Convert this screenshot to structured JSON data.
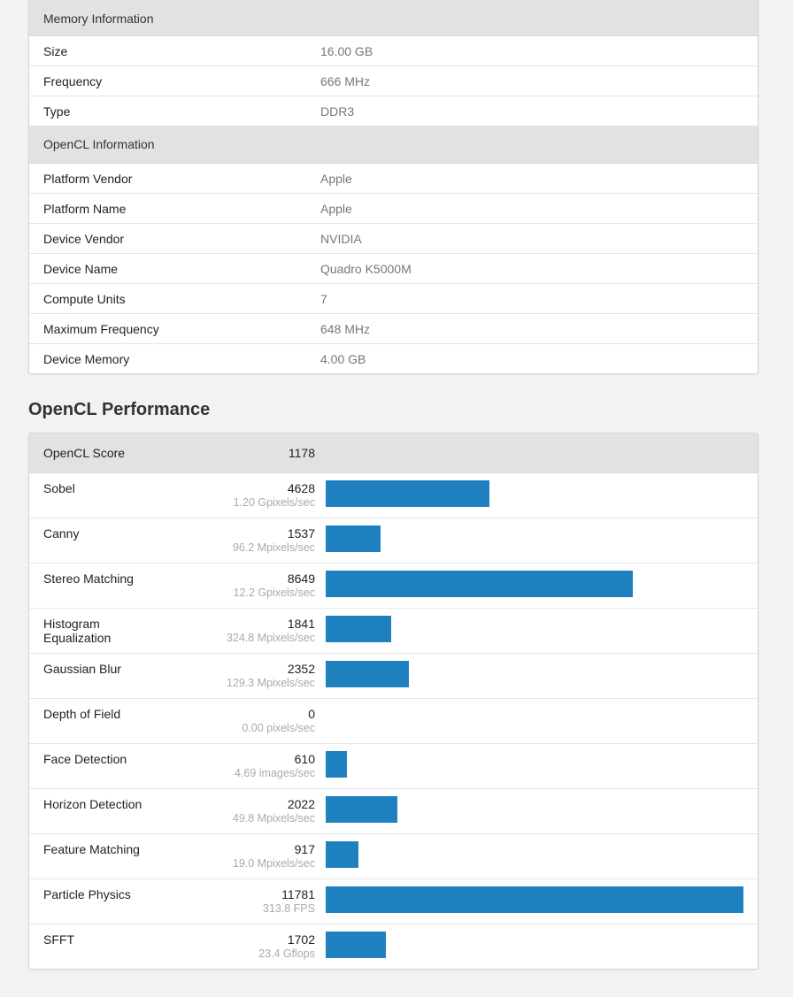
{
  "memory": {
    "header": "Memory Information",
    "rows": [
      {
        "key": "Size",
        "value": "16.00 GB"
      },
      {
        "key": "Frequency",
        "value": "666 MHz"
      },
      {
        "key": "Type",
        "value": "DDR3"
      }
    ]
  },
  "opencl_info": {
    "header": "OpenCL Information",
    "rows": [
      {
        "key": "Platform Vendor",
        "value": "Apple"
      },
      {
        "key": "Platform Name",
        "value": "Apple"
      },
      {
        "key": "Device Vendor",
        "value": "NVIDIA"
      },
      {
        "key": "Device Name",
        "value": "Quadro K5000M"
      },
      {
        "key": "Compute Units",
        "value": "7"
      },
      {
        "key": "Maximum Frequency",
        "value": "648 MHz"
      },
      {
        "key": "Device Memory",
        "value": "4.00 GB"
      }
    ]
  },
  "performance": {
    "title": "OpenCL Performance",
    "score_label": "OpenCL Score",
    "score_value": "1178",
    "bar_color": "#1f80c0",
    "bar_max": 11781,
    "benchmarks": [
      {
        "name": "Sobel",
        "score": 4628,
        "rate": "1.20 Gpixels/sec"
      },
      {
        "name": "Canny",
        "score": 1537,
        "rate": "96.2 Mpixels/sec"
      },
      {
        "name": "Stereo Matching",
        "score": 8649,
        "rate": "12.2 Gpixels/sec"
      },
      {
        "name": "Histogram Equalization",
        "score": 1841,
        "rate": "324.8 Mpixels/sec"
      },
      {
        "name": "Gaussian Blur",
        "score": 2352,
        "rate": "129.3 Mpixels/sec"
      },
      {
        "name": "Depth of Field",
        "score": 0,
        "rate": "0.00 pixels/sec"
      },
      {
        "name": "Face Detection",
        "score": 610,
        "rate": "4.69 images/sec"
      },
      {
        "name": "Horizon Detection",
        "score": 2022,
        "rate": "49.8 Mpixels/sec"
      },
      {
        "name": "Feature Matching",
        "score": 917,
        "rate": "19.0 Mpixels/sec"
      },
      {
        "name": "Particle Physics",
        "score": 11781,
        "rate": "313.8 FPS"
      },
      {
        "name": "SFFT",
        "score": 1702,
        "rate": "23.4 Gflops"
      }
    ]
  }
}
